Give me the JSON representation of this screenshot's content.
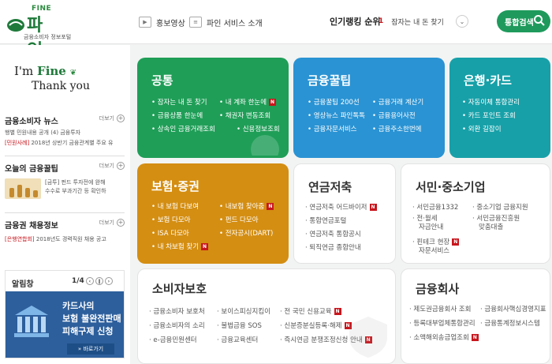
{
  "header": {
    "logo_top": "FINE",
    "logo_name": "파 인",
    "logo_sub": "금융소비자 정보포털",
    "promo_video": "홍보영상",
    "service_intro": "파인 서비스 소개",
    "ranking_title": "인기랭킹 순위",
    "ranking_number": "1",
    "ranking_item": "잠자는 내 돈 찾기",
    "search_label": "통합검색"
  },
  "sidebar": {
    "banner_line1_prefix": "I'm ",
    "banner_line1_brand": "Fine",
    "banner_line2": "Thank you",
    "more_label": "더보기",
    "news_title": "금융소비자 뉴스",
    "news_line1": "행별 민원내용 공개 (4) 금융투자",
    "news_line2_tag": "[민원사례]",
    "news_line2": " 2018년 상반기 금융관계별 주요 유",
    "tip_title": "오늘의 금융꿀팁",
    "tip_text1": "[금투] 펀드 투자전에 완해",
    "tip_text2": "수수로 부과기간 등 확인하",
    "job_title": "금융권 채용정보",
    "job_tag": "[은행연합회]",
    "job_text": " 2018년도 경력직원 채용 공고",
    "notice_title": "알림창",
    "notice_page": "1/4",
    "notice_line1": "카드사의",
    "notice_line2": "보험 불완전판매",
    "notice_line3": "피해구제 신청",
    "notice_button": "» 바로가기"
  },
  "tiles": {
    "common": {
      "title": "공통",
      "items": [
        "잠자는 내 돈 찾기",
        "내 계좌 한눈에",
        "금융상품 한눈에",
        "채권자 변동조회",
        "상속인 금융거래조회",
        "신용정보조회"
      ],
      "badge": "N"
    },
    "tips": {
      "title": "금융꿀팁",
      "items": [
        "금융꿀팁 200선",
        "금융거래 계산기",
        "영상뉴스 파인톡톡",
        "금융용어사전",
        "금융자문서비스",
        "금융주소한번에"
      ]
    },
    "bank": {
      "title": "은행·카드",
      "items": [
        "자동이체 통합관리",
        "카드 포인트 조회",
        "외환 길잡이"
      ]
    },
    "insurance": {
      "title": "보험·증권",
      "items": [
        "내 보험 다보여",
        "내보험 찾아줌",
        "보험 다모아",
        "펀드 다모아",
        "ISA 다모아",
        "전자공시(DART)",
        "내 차보험 찾기"
      ]
    },
    "pension": {
      "title": "연금저축",
      "items": [
        "연금저축 어드바이저",
        "통합연금포털",
        "연금저축 통합공시",
        "퇴직연금 종합안내"
      ]
    },
    "sme": {
      "title": "서민·중소기업",
      "items": [
        "서민금융1332",
        "중소기업 금융지원",
        "전·월세",
        "자금안내",
        "서민금융진흥원",
        "맞춤대출",
        "핀테크 현장",
        "자문서비스"
      ]
    },
    "consumer": {
      "title": "소비자보호",
      "items": [
        "금융소비자 보호처",
        "보이스피싱지킴이",
        "전 국민 신용교육",
        "금융소비자의 소리",
        "불법금융 SOS",
        "신분증분실등록·해제",
        "e-금융민원센터",
        "금융교육센터",
        "즉시연금 분쟁조정신청 안내"
      ]
    },
    "company": {
      "title": "금융회사",
      "items": [
        "제도권금융회사 조회",
        "금융회사핵심경영지표",
        "등록대부업체통합관리",
        "금융통계정보시스템",
        "소액해외송금업조회"
      ]
    }
  },
  "colors": {
    "green": "#1f9e57",
    "blue": "#2a93d3",
    "teal": "#17a0a8",
    "gold": "#d48e12",
    "badge_red": "#c8161d"
  }
}
